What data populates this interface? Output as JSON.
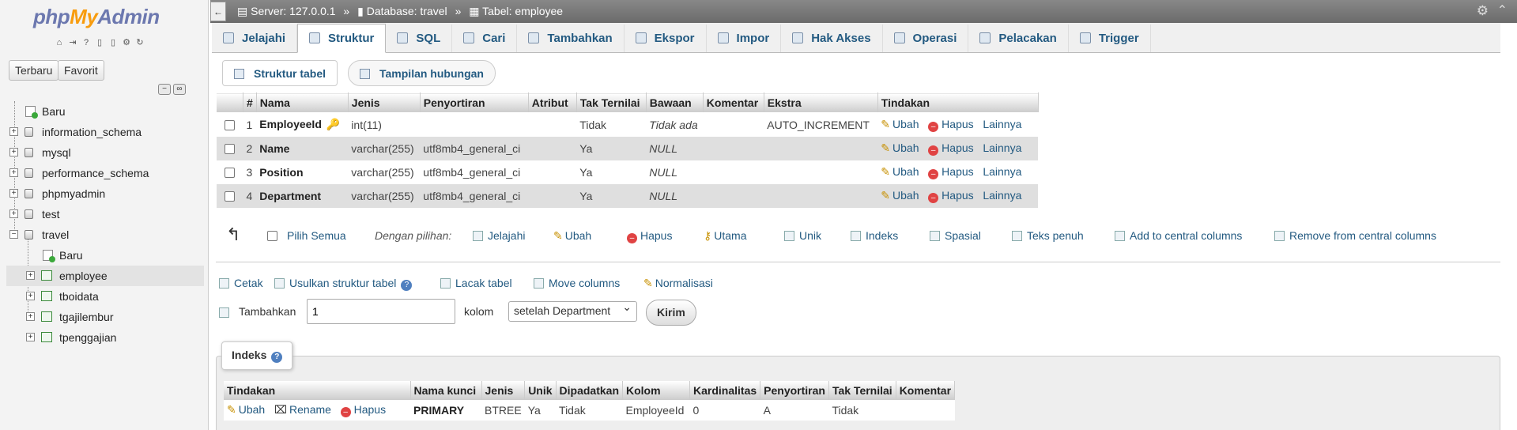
{
  "logo": {
    "php": "php",
    "my": "My",
    "admin": "Admin"
  },
  "nav": {
    "recent_label": "Terbaru",
    "favorite_label": "Favorit",
    "tree": [
      {
        "label": "Baru",
        "kind": "new"
      },
      {
        "label": "information_schema",
        "kind": "db"
      },
      {
        "label": "mysql",
        "kind": "db"
      },
      {
        "label": "performance_schema",
        "kind": "db"
      },
      {
        "label": "phpmyadmin",
        "kind": "db"
      },
      {
        "label": "test",
        "kind": "db"
      },
      {
        "label": "travel",
        "kind": "db-open"
      },
      {
        "label": "Baru",
        "kind": "new-child"
      },
      {
        "label": "employee",
        "kind": "table"
      },
      {
        "label": "tboidata",
        "kind": "table"
      },
      {
        "label": "tgajilembur",
        "kind": "table"
      },
      {
        "label": "tpenggajian",
        "kind": "table"
      }
    ]
  },
  "breadcrumb": {
    "server": "Server: 127.0.0.1",
    "database": "Database: travel",
    "table": "Tabel: employee"
  },
  "tabs": [
    "Jelajahi",
    "Struktur",
    "SQL",
    "Cari",
    "Tambahkan",
    "Ekspor",
    "Impor",
    "Hak Akses",
    "Operasi",
    "Pelacakan",
    "Trigger"
  ],
  "active_tab": "Struktur",
  "subtabs": {
    "structure": "Struktur tabel",
    "relation": "Tampilan hubungan"
  },
  "columns_headers": [
    "#",
    "Nama",
    "Jenis",
    "Penyortiran",
    "Atribut",
    "Tak Ternilai",
    "Bawaan",
    "Komentar",
    "Ekstra",
    "Tindakan"
  ],
  "columns": [
    {
      "num": "1",
      "name": "EmployeeId",
      "type": "int(11)",
      "collation": "",
      "attributes": "",
      "null": "Tidak",
      "default": "Tidak ada",
      "comment": "",
      "extra": "AUTO_INCREMENT"
    },
    {
      "num": "2",
      "name": "Name",
      "type": "varchar(255)",
      "collation": "utf8mb4_general_ci",
      "attributes": "",
      "null": "Ya",
      "default": "NULL",
      "comment": "",
      "extra": ""
    },
    {
      "num": "3",
      "name": "Position",
      "type": "varchar(255)",
      "collation": "utf8mb4_general_ci",
      "attributes": "",
      "null": "Ya",
      "default": "NULL",
      "comment": "",
      "extra": ""
    },
    {
      "num": "4",
      "name": "Department",
      "type": "varchar(255)",
      "collation": "utf8mb4_general_ci",
      "attributes": "",
      "null": "Ya",
      "default": "NULL",
      "comment": "",
      "extra": ""
    }
  ],
  "row_actions": {
    "change": "Ubah",
    "drop": "Hapus",
    "more": "Lainnya"
  },
  "bulk": {
    "check_all": "Pilih Semua",
    "with_selected": "Dengan pilihan:",
    "browse": "Jelajahi",
    "change": "Ubah",
    "drop": "Hapus",
    "primary": "Utama",
    "unique": "Unik",
    "index": "Indeks",
    "spatial": "Spasial",
    "fulltext": "Teks penuh",
    "add_central": "Add to central columns",
    "remove_central": "Remove from central columns"
  },
  "tools": {
    "print": "Cetak",
    "propose": "Usulkan struktur tabel",
    "track": "Lacak tabel",
    "move": "Move columns",
    "normalize": "Normalisasi"
  },
  "add_columns": {
    "label": "Tambahkan",
    "count": "1",
    "unit": "kolom",
    "position": "setelah Department",
    "submit": "Kirim"
  },
  "indexes": {
    "title": "Indeks",
    "headers": [
      "Tindakan",
      "Nama kunci",
      "Jenis",
      "Unik",
      "Dipadatkan",
      "Kolom",
      "Kardinalitas",
      "Penyortiran",
      "Tak Ternilai",
      "Komentar"
    ],
    "actions": {
      "change": "Ubah",
      "rename": "Rename",
      "drop": "Hapus"
    },
    "rows": [
      {
        "keyname": "PRIMARY",
        "type": "BTREE",
        "unique": "Ya",
        "packed": "Tidak",
        "column": "EmployeeId",
        "cardinality": "0",
        "collation": "A",
        "null": "Tidak",
        "comment": ""
      }
    ]
  }
}
